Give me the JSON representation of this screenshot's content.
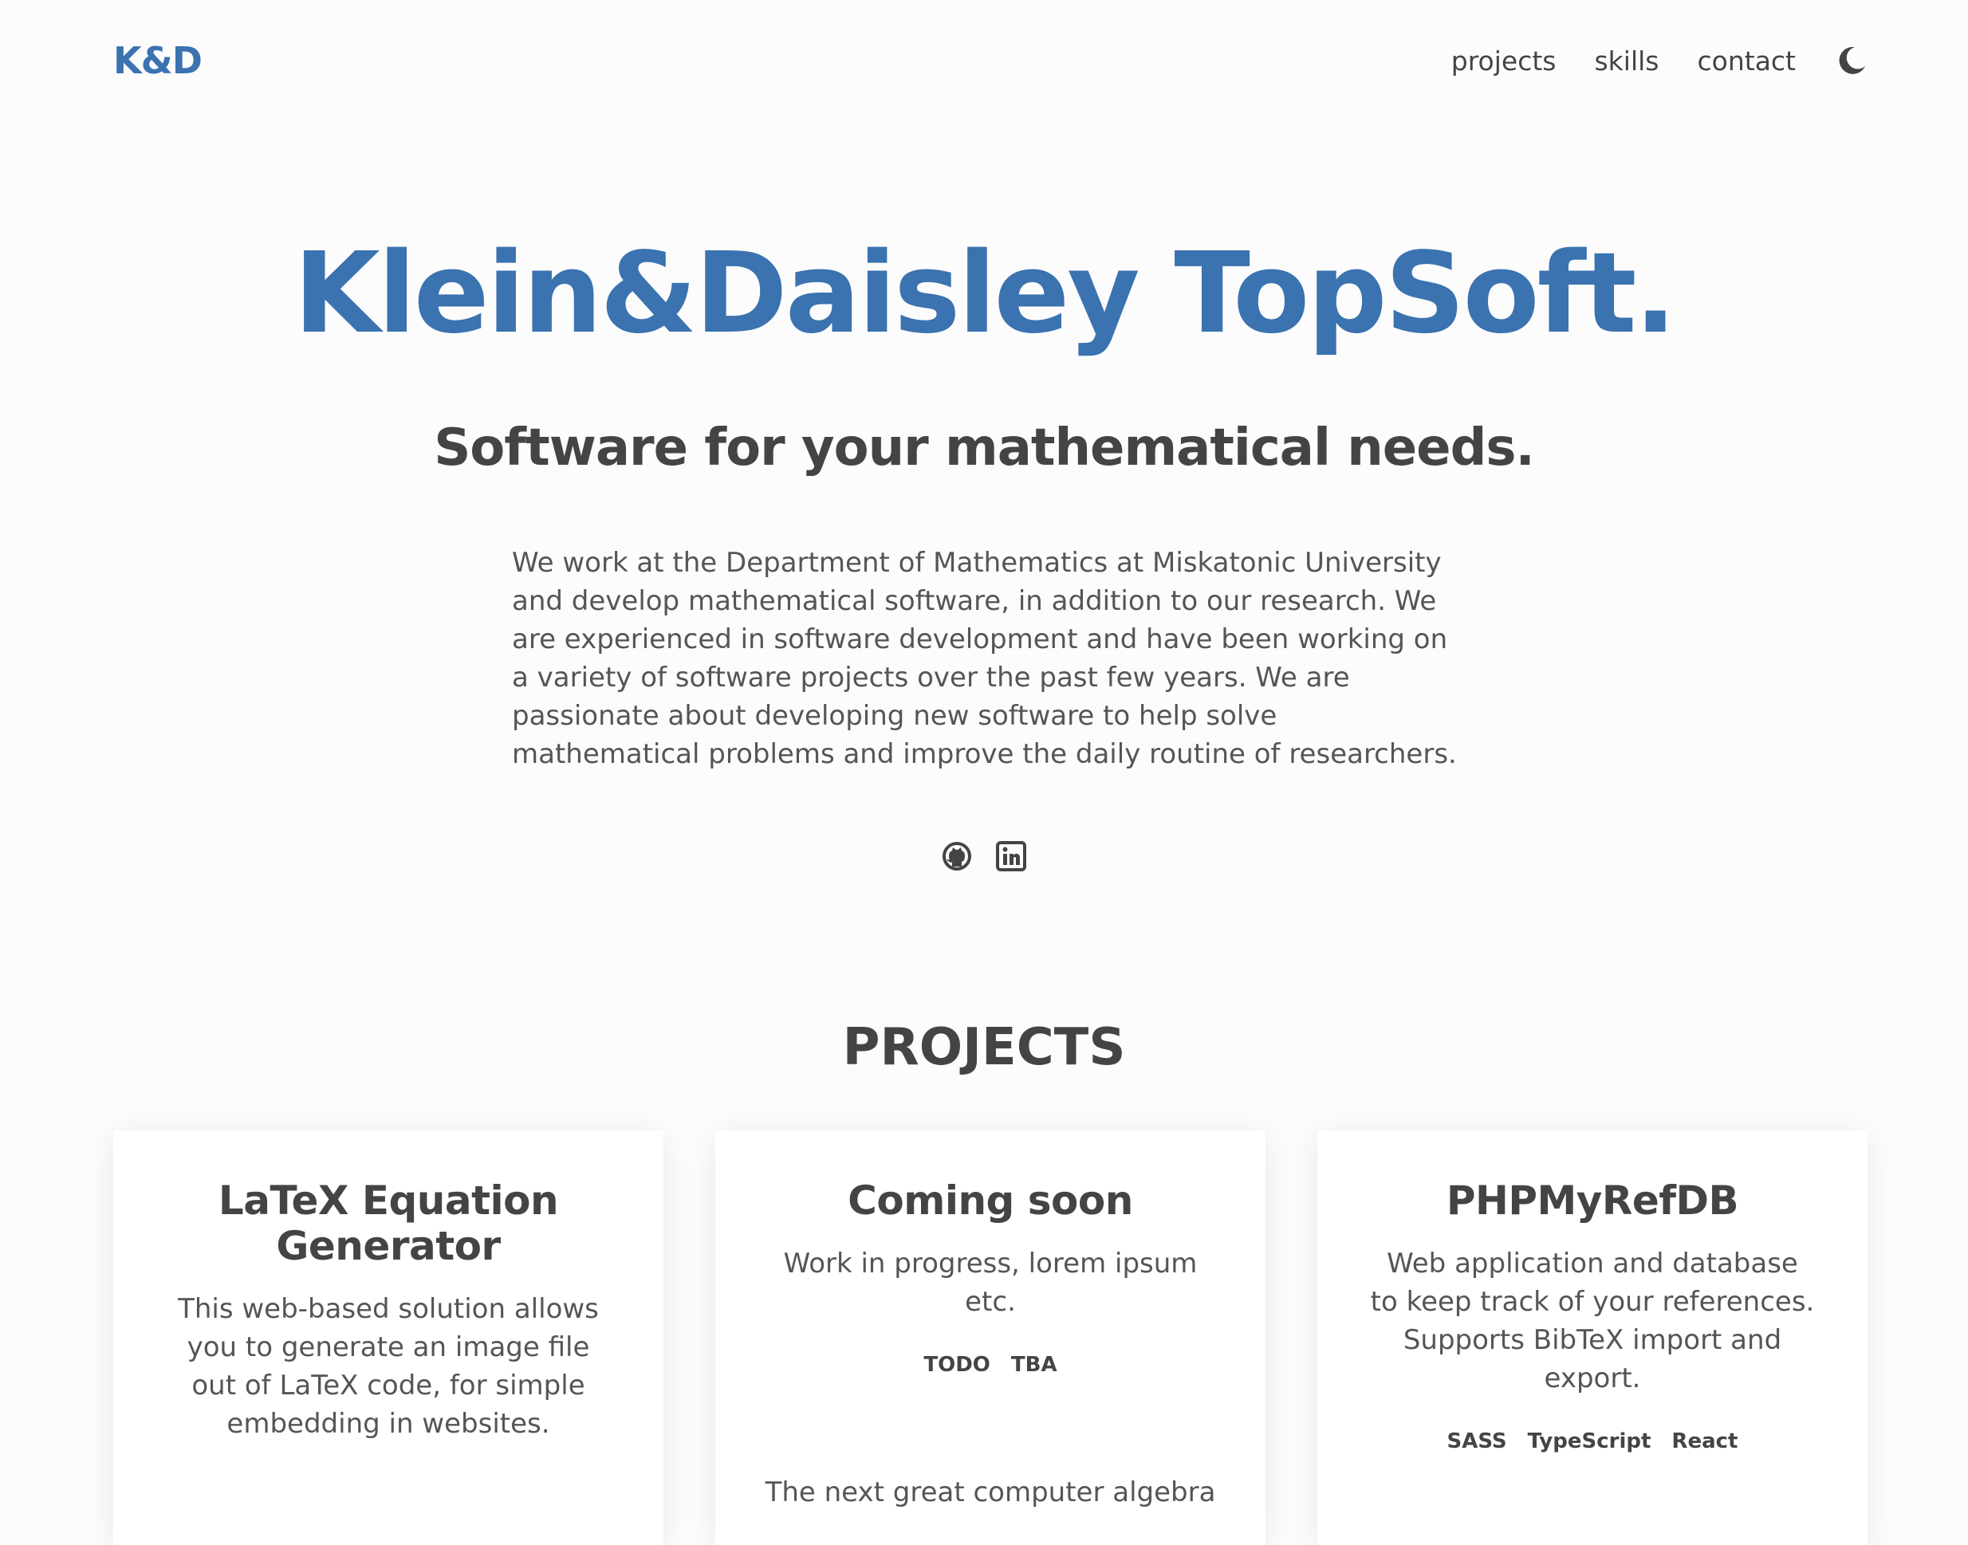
{
  "header": {
    "logo": "K&D",
    "nav": [
      "projects",
      "skills",
      "contact"
    ],
    "theme_icon": "moon-icon"
  },
  "hero": {
    "title": "Klein&Daisley TopSoft.",
    "subtitle": "Software for your mathematical needs.",
    "description": "We work at the Department of Mathematics at Miskatonic University and develop mathematical software, in addition to our research. We are experienced in software development and have been working on a variety of software projects over the past few years. We are passionate about developing new software to help solve mathematical problems and improve the daily routine of researchers.",
    "socials": [
      "github-icon",
      "linkedin-icon"
    ]
  },
  "projects": {
    "heading": "PROJECTS",
    "cards": [
      {
        "title": "LaTeX Equation Generator",
        "description": "This web-based solution allows you to generate an image file out of LaTeX code, for simple embedding in websites.",
        "tags": []
      },
      {
        "title": "Coming soon",
        "description": "Work in progress, lorem ipsum etc.",
        "tags": [
          "TODO",
          "TBA"
        ],
        "extra": "The next great computer algebra"
      },
      {
        "title": "PHPMyRefDB",
        "description": "Web application and database to keep track of your references. Supports BibTeX import and export.",
        "tags": [
          "SASS",
          "TypeScript",
          "React"
        ]
      }
    ]
  },
  "colors": {
    "accent": "#3b72b0",
    "text": "#444444",
    "background": "#fcfcfc"
  }
}
